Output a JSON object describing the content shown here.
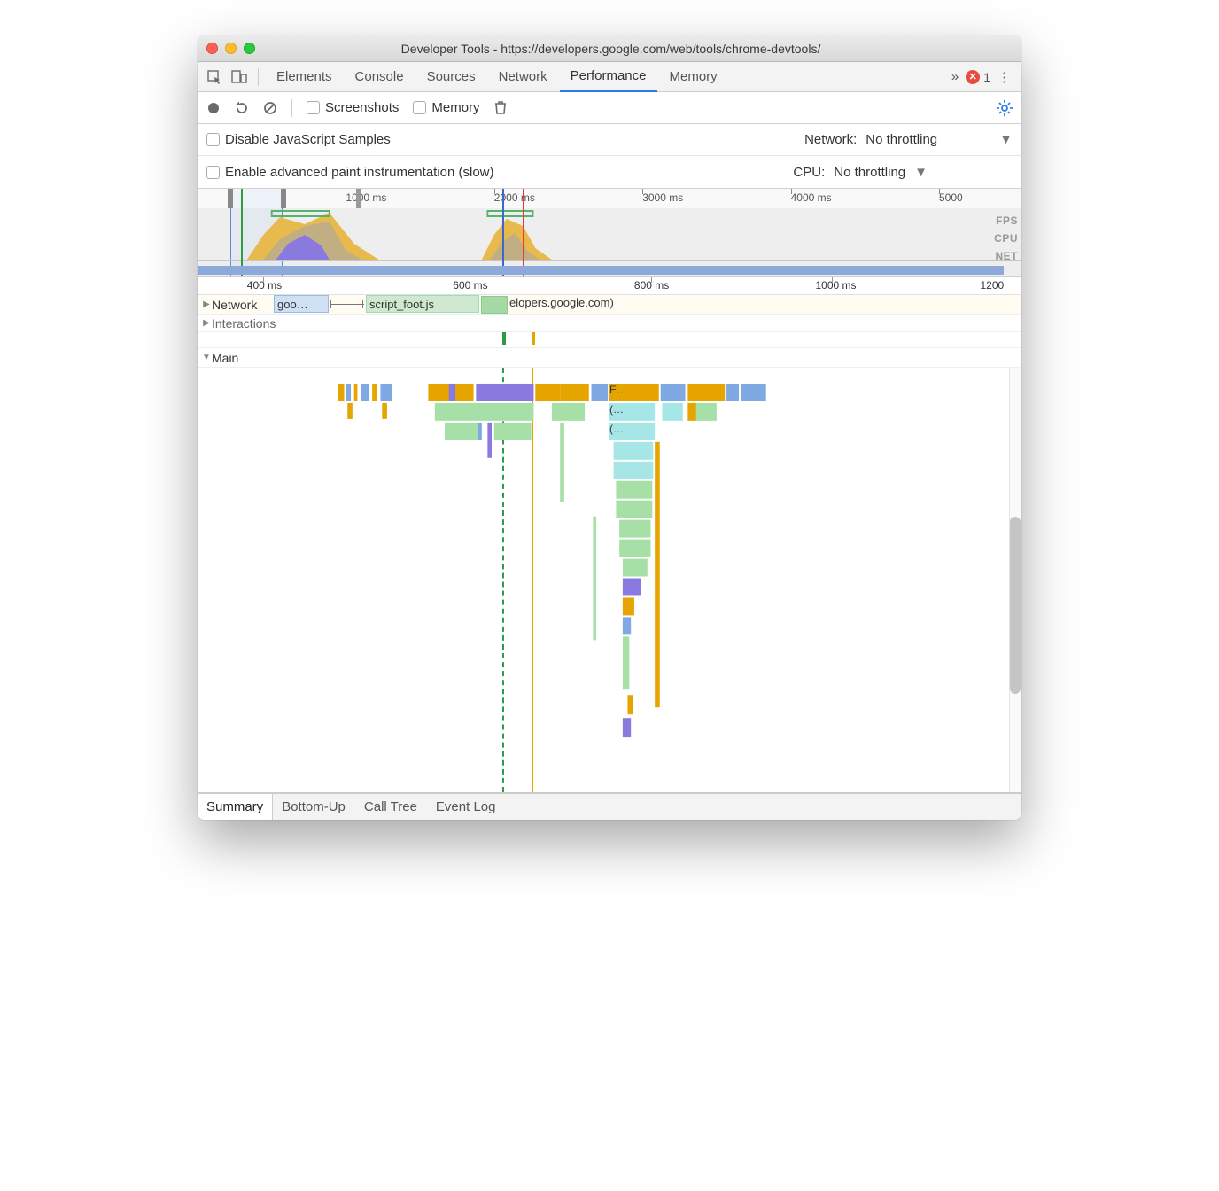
{
  "window": {
    "title": "Developer Tools - https://developers.google.com/web/tools/chrome-devtools/"
  },
  "tabs": {
    "items": [
      "Elements",
      "Console",
      "Sources",
      "Network",
      "Performance",
      "Memory"
    ],
    "active": "Performance",
    "more": "»",
    "errors": "1"
  },
  "toolbar": {
    "screenshots": "Screenshots",
    "memory": "Memory"
  },
  "settings": {
    "disable_js": "Disable JavaScript Samples",
    "adv_paint": "Enable advanced paint instrumentation (slow)",
    "network_label": "Network:",
    "network_value": "No throttling",
    "cpu_label": "CPU:",
    "cpu_value": "No throttling"
  },
  "overview": {
    "ticks": [
      "1000 ms",
      "2000 ms",
      "3000 ms",
      "4000 ms",
      "5000"
    ],
    "tick_positions": [
      18,
      36,
      54,
      72,
      90
    ],
    "labels": [
      "FPS",
      "CPU",
      "NET"
    ],
    "selection_pct": [
      4,
      10.3
    ],
    "markers": {
      "green_pct": 5.3,
      "blue_pct": 37,
      "red_pct": 39.5
    }
  },
  "ruler": {
    "ticks": [
      "400 ms",
      "600 ms",
      "800 ms",
      "1000 ms",
      "1200"
    ],
    "tick_positions_pct": [
      8,
      33,
      55,
      77,
      98
    ]
  },
  "rows": {
    "network": "Network",
    "net_item_blue": "goo…",
    "net_item_green": "script_foot.js",
    "net_item_tail": "elopers.google.com)",
    "interactions": "Interactions",
    "main": "Main",
    "flame_labels": {
      "e": "E…",
      "p1": "(…",
      "p2": "(…"
    }
  },
  "bottom_tabs": {
    "items": [
      "Summary",
      "Bottom-Up",
      "Call Tree",
      "Event Log"
    ],
    "active": "Summary"
  },
  "colors": {
    "script": "#efb23e",
    "script2": "#e6a400",
    "render": "#8a7ae0",
    "paint": "#7ad3c6",
    "idle": "#a6e0a6",
    "blue": "#7ea9e2",
    "cyan": "#a6e6e6",
    "green": "#9ed29e"
  }
}
